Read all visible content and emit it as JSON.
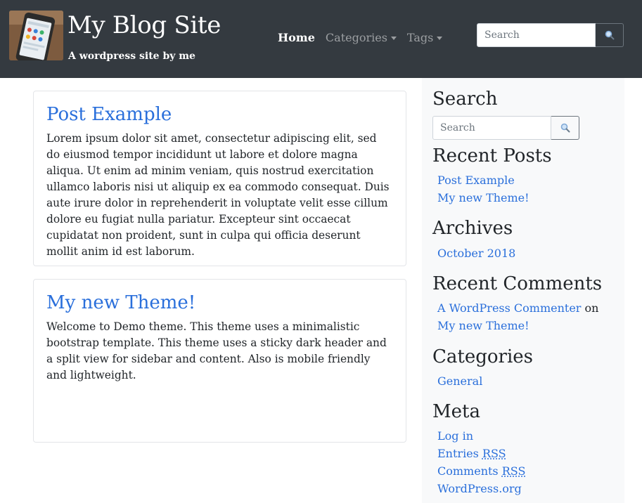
{
  "header": {
    "site_title": "My Blog Site",
    "tagline": "A wordpress site by me",
    "nav": {
      "home": "Home",
      "categories": "Categories",
      "tags": "Tags"
    },
    "search_placeholder": "Search"
  },
  "posts": [
    {
      "title": "Post Example",
      "body": "Lorem ipsum dolor sit amet, consectetur adipiscing elit, sed do eiusmod tempor incididunt ut labore et dolore magna aliqua. Ut enim ad minim veniam, quis nostrud exercitation ullamco laboris nisi ut aliquip ex ea commodo consequat. Duis aute irure dolor in reprehenderit in voluptate velit esse cillum dolore eu fugiat nulla pariatur. Excepteur sint occaecat cupidatat non proident, sunt in culpa qui officia deserunt mollit anim id est laborum."
    },
    {
      "title": "My new Theme!",
      "body": "Welcome to Demo theme. This theme uses a minimalistic bootstrap template.  This theme uses a sticky dark header and a split view for sidebar and content. Also is mobile friendly and lightweight."
    }
  ],
  "sidebar": {
    "search": {
      "title": "Search",
      "placeholder": "Search"
    },
    "recent_posts": {
      "title": "Recent Posts",
      "items": [
        "Post Example",
        "My new Theme!"
      ]
    },
    "archives": {
      "title": "Archives",
      "items": [
        "October 2018"
      ]
    },
    "recent_comments": {
      "title": "Recent Comments",
      "author": "A WordPress Commenter",
      "connector": "on",
      "post": "My new Theme!"
    },
    "categories": {
      "title": "Categories",
      "items": [
        "General"
      ]
    },
    "meta": {
      "title": "Meta",
      "login": "Log in",
      "entries_prefix": "Entries",
      "comments_prefix": "Comments",
      "rss": "RSS",
      "wordpress_org": "WordPress.org"
    }
  },
  "colors": {
    "header_bg": "#343a40",
    "link": "#2a6fdb",
    "sidebar_bg": "#f8f9fa"
  },
  "icons": {
    "search_button": "magnifier-icon",
    "dropdown": "caret-down-icon",
    "logo": "phone-photo-logo"
  }
}
